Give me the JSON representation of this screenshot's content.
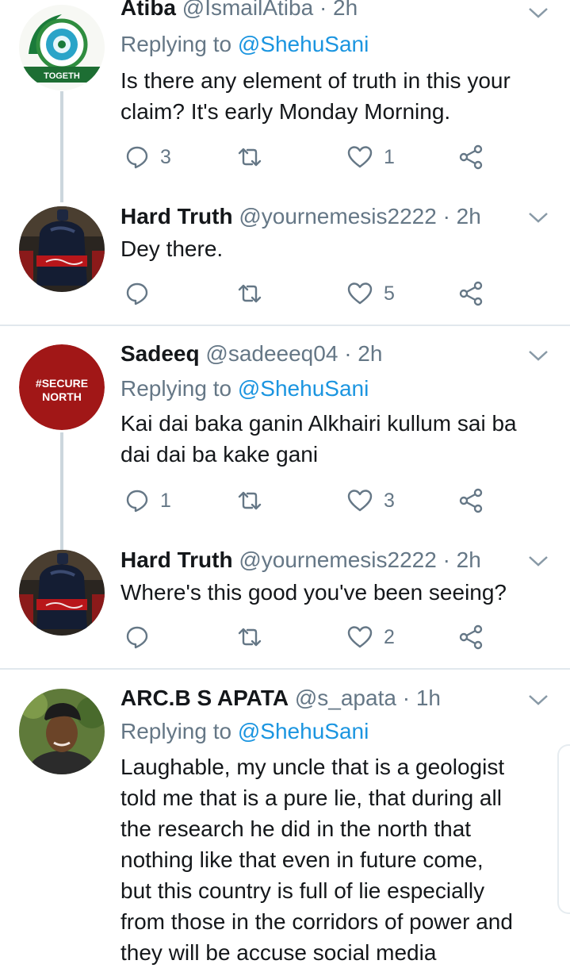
{
  "tweets": [
    {
      "name": "Atiba",
      "handle": "@IsmailAtiba",
      "time": "· 2h",
      "reply_prefix": "Replying to",
      "reply_to": "@ShehuSani",
      "text": [
        "Is there any element of truth in this your",
        "claim? It's early Monday Morning."
      ],
      "reply_count": "3",
      "retweet_count": "",
      "like_count": "1",
      "avatar_text": "TOGETH"
    },
    {
      "name": "Hard Truth",
      "handle": "@yournemesis2222",
      "time": "· 2h",
      "text": [
        "Dey there."
      ],
      "reply_count": "",
      "retweet_count": "",
      "like_count": "5"
    },
    {
      "name": "Sadeeq",
      "handle": "@sadeeeq04",
      "time": "· 2h",
      "reply_prefix": "Replying to",
      "reply_to": "@ShehuSani",
      "text": [
        "Kai dai baka ganin Alkhairi kullum sai ba",
        "dai dai ba kake gani"
      ],
      "reply_count": "1",
      "retweet_count": "",
      "like_count": "3",
      "avatar_text_1": "#SECURE",
      "avatar_text_2": "NORTH"
    },
    {
      "name": "Hard Truth",
      "handle": "@yournemesis2222",
      "time": "· 2h",
      "text": [
        "Where's this good you've been seeing?"
      ],
      "reply_count": "",
      "retweet_count": "",
      "like_count": "2"
    },
    {
      "name": "ARC.B S APATA",
      "handle": "@s_apata",
      "time": "· 1h",
      "reply_prefix": "Replying to",
      "reply_to": "@ShehuSani",
      "text": [
        "Laughable, my uncle that is a geologist",
        "told me that is a pure lie, that during all",
        "the research he did in the north that",
        "nothing like that even in future  come,",
        "but this country is full of lie especially",
        "from those in the corridors of power and",
        "they will be accuse social media"
      ]
    }
  ],
  "colors": {
    "accent": "#1b95e0",
    "secondary_text": "#657786",
    "divider": "#e1e8ed",
    "thread_line": "#ccd6dd"
  },
  "icons": [
    "reply-icon",
    "retweet-icon",
    "like-icon",
    "share-icon",
    "chevron-down-icon"
  ]
}
